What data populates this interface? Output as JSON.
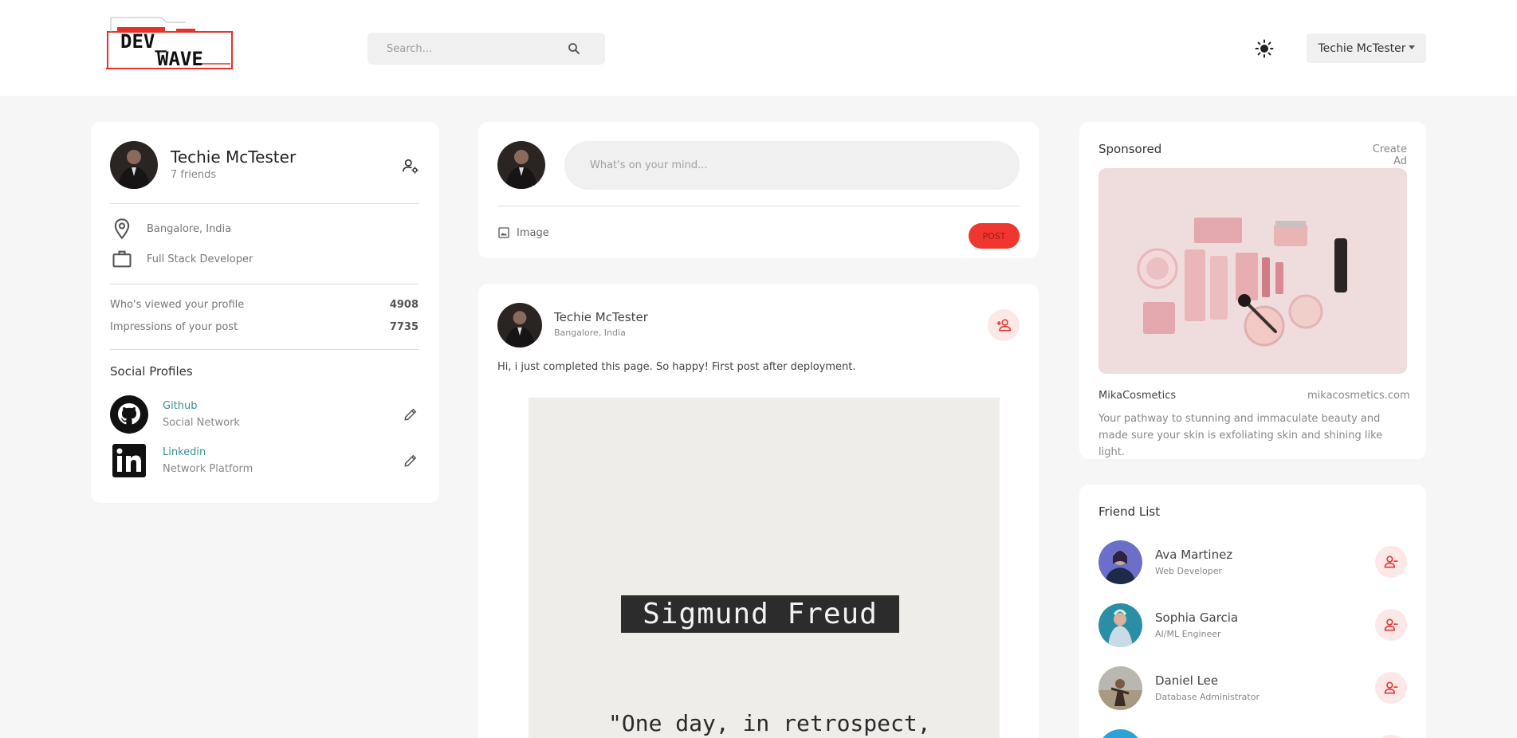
{
  "navbar": {
    "logo_text_line1": "DEV_",
    "logo_text_line2": "WAVE",
    "search_placeholder": "Search...",
    "search_icon": "search-icon",
    "theme_icon": "sun-icon",
    "user_name": "Techie McTester"
  },
  "profile": {
    "name": "Techie McTester",
    "friends": "7 friends",
    "location": "Bangalore, India",
    "occupation": "Full Stack Developer",
    "stats": [
      {
        "label": "Who's viewed your profile",
        "value": "4908"
      },
      {
        "label": "Impressions of your post",
        "value": "7735"
      }
    ],
    "social_title": "Social Profiles",
    "socials": [
      {
        "name": "Github",
        "sub": "Social Network",
        "icon": "github-icon"
      },
      {
        "name": "Linkedin",
        "sub": "Network Platform",
        "icon": "linkedin-icon"
      }
    ]
  },
  "composer": {
    "placeholder": "What's on your mind...",
    "image_label": "Image",
    "post_label": "POST"
  },
  "post": {
    "author": "Techie McTester",
    "location": "Bangalore, India",
    "text": "Hi, i just completed this page. So happy! First post after deployment.",
    "image_title": "Sigmund Freud",
    "image_quote": "\"One day, in retrospect,"
  },
  "sponsored": {
    "title": "Sponsored",
    "create_label": "Create Ad",
    "brand": "MikaCosmetics",
    "url": "mikacosmetics.com",
    "description": "Your pathway to stunning and immaculate beauty and made sure your skin is exfoliating skin and shining like light."
  },
  "friend_list": {
    "title": "Friend List",
    "friends": [
      {
        "name": "Ava Martinez",
        "role": "Web Developer"
      },
      {
        "name": "Sophia Garcia",
        "role": "AI/ML Engineer"
      },
      {
        "name": "Daniel Lee",
        "role": "Database Administrator"
      }
    ]
  },
  "colors": {
    "accent": "#f0362e",
    "link": "#3f8f8f",
    "background": "#f6f6f6"
  }
}
